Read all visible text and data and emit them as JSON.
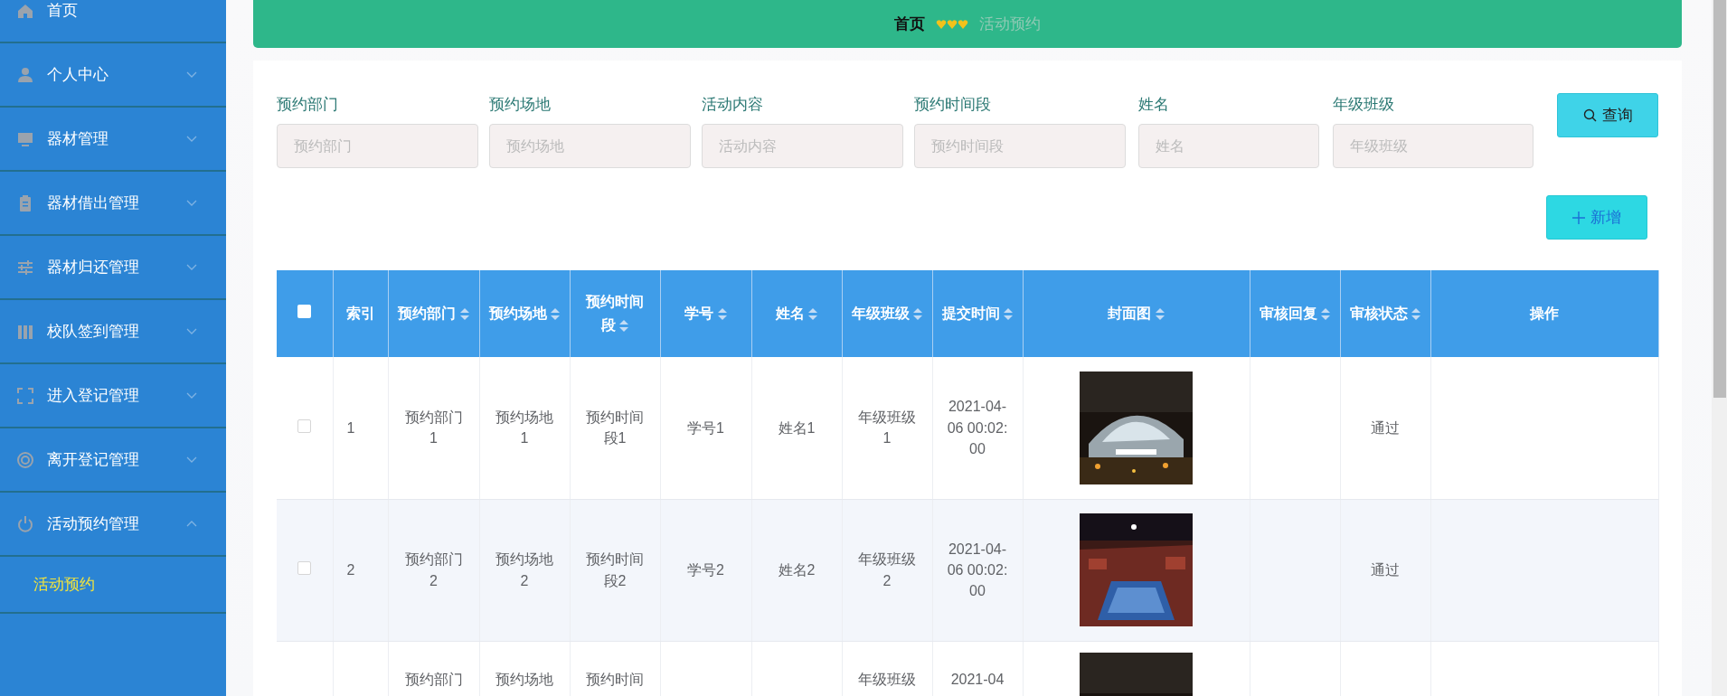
{
  "sidebar": {
    "items": [
      {
        "label": "首页",
        "kind": "link"
      },
      {
        "label": "个人中心",
        "kind": "menu",
        "expanded": false
      },
      {
        "label": "器材管理",
        "kind": "menu",
        "expanded": false
      },
      {
        "label": "器材借出管理",
        "kind": "menu",
        "expanded": false
      },
      {
        "label": "器材归还管理",
        "kind": "menu",
        "expanded": false
      },
      {
        "label": "校队签到管理",
        "kind": "menu",
        "expanded": false
      },
      {
        "label": "进入登记管理",
        "kind": "menu",
        "expanded": false
      },
      {
        "label": "离开登记管理",
        "kind": "menu",
        "expanded": false
      },
      {
        "label": "活动预约管理",
        "kind": "menu",
        "expanded": true,
        "children": [
          {
            "label": "活动预约",
            "selected": true
          }
        ]
      }
    ]
  },
  "breadcrumb": {
    "items": [
      "首页",
      "活动预约"
    ]
  },
  "search": {
    "fields": [
      {
        "label": "预约部门",
        "placeholder": "预约部门"
      },
      {
        "label": "预约场地",
        "placeholder": "预约场地"
      },
      {
        "label": "活动内容",
        "placeholder": "活动内容"
      },
      {
        "label": "预约时间段",
        "placeholder": "预约时间段"
      },
      {
        "label": "姓名",
        "placeholder": "姓名"
      },
      {
        "label": "年级班级",
        "placeholder": "年级班级"
      }
    ],
    "query_button": "查询",
    "add_button": "新增"
  },
  "table": {
    "select_all": {
      "checked": false
    },
    "columns": [
      {
        "label": "索引",
        "sortable": false
      },
      {
        "label": "预约部门",
        "sortable": true
      },
      {
        "label": "预约场地",
        "sortable": true
      },
      {
        "label": "预约时间段",
        "sortable": true
      },
      {
        "label": "学号",
        "sortable": true
      },
      {
        "label": "姓名",
        "sortable": true
      },
      {
        "label": "年级班级",
        "sortable": true
      },
      {
        "label": "提交时间",
        "sortable": true
      },
      {
        "label": "封面图",
        "sortable": true
      },
      {
        "label": "审核回复",
        "sortable": true
      },
      {
        "label": "审核状态",
        "sortable": true
      },
      {
        "label": "操作",
        "sortable": false
      }
    ],
    "rows": [
      {
        "checked": false,
        "cells": [
          "1",
          "预约部门1",
          "预约场地1",
          "预约时间段1",
          "学号1",
          "姓名1",
          "年级班级1",
          "2021-04-06 00:02:00",
          {
            "kind": "picture"
          },
          null,
          "通过",
          null
        ]
      },
      {
        "checked": false,
        "cells": [
          "2",
          "预约部门2",
          "预约场地2",
          "预约时间段2",
          "学号2",
          "姓名2",
          "年级班级2",
          "2021-04-06 00:02:00",
          {
            "kind": "picture"
          },
          null,
          "通过",
          null
        ]
      },
      {
        "cells": [
          null,
          "预约部门",
          "预约场地",
          "预约时间",
          null,
          null,
          "年级班级",
          "2021-04",
          {
            "kind": "picture"
          },
          null,
          null,
          null
        ]
      }
    ]
  }
}
